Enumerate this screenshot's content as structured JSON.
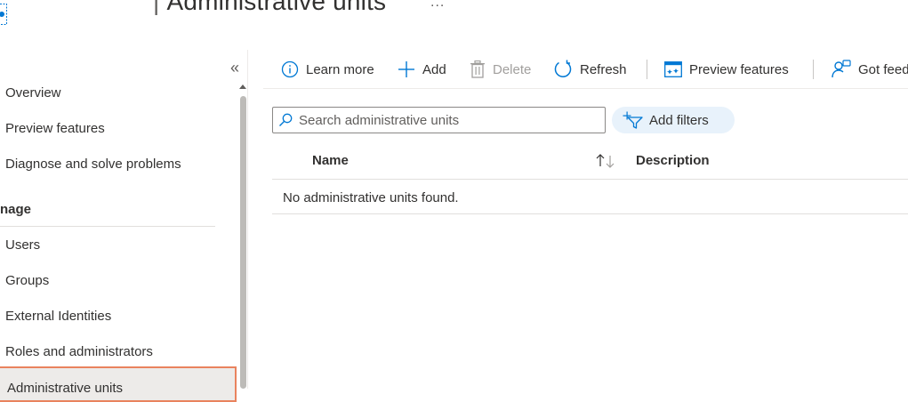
{
  "header": {
    "title": "Administrative units",
    "more_label": "..."
  },
  "sidebar": {
    "collapse_label": "«",
    "top_items": [
      {
        "label": "Overview"
      },
      {
        "label": "Preview features"
      },
      {
        "label": "Diagnose and solve problems"
      }
    ],
    "section_label": "nage",
    "manage_items": [
      {
        "label": "Users"
      },
      {
        "label": "Groups"
      },
      {
        "label": "External Identities"
      },
      {
        "label": "Roles and administrators"
      },
      {
        "label": "Administrative units",
        "selected": true
      }
    ]
  },
  "toolbar": {
    "learn_more": "Learn more",
    "add": "Add",
    "delete": "Delete",
    "refresh": "Refresh",
    "preview_features": "Preview features",
    "got_feedback": "Got feedback?"
  },
  "search": {
    "placeholder": "Search administrative units",
    "value": ""
  },
  "filters": {
    "label": "Add filters"
  },
  "table": {
    "columns": [
      "Name",
      "Description"
    ],
    "empty_message": "No administrative units found."
  },
  "colors": {
    "accent": "#0078d4",
    "selected_border": "#e9835e",
    "selected_bg": "#edebe9",
    "filter_bg": "#e8f2fb"
  }
}
